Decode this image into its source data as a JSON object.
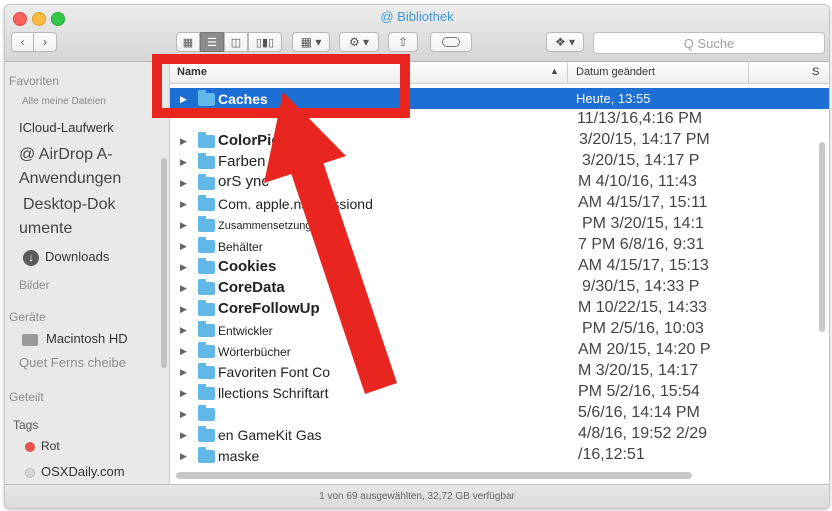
{
  "window": {
    "title": "@ Bibliothek"
  },
  "toolbar": {
    "search_placeholder": "Q Suche"
  },
  "sidebar": {
    "favorites_header": "Favoriten",
    "favorites": [
      "Alle meine Dateien",
      "ICloud-Laufwerk",
      "@ AirDrop A-",
      "Anwendungen",
      "Desktop-Dok",
      "umente",
      "Downloads",
      "Bilder"
    ],
    "devices_header": "Geräte",
    "devices": [
      "Macintosh HD",
      "Quet Ferns cheibe"
    ],
    "shared_header": "Geteilt",
    "tags_header": "Tags",
    "tags": [
      "Rot",
      "OSXDaily.com"
    ],
    "tag_colors": [
      "#e5534b",
      "#d7d7d7"
    ]
  },
  "columns": {
    "name": "Name",
    "date": "Datum geändert",
    "third": "S"
  },
  "rows": [
    {
      "name": "Caches",
      "date": "Heute, 13:55"
    },
    {
      "name": "",
      "date": "11/13/16,4:16 PM"
    },
    {
      "name": "ColorPick",
      "date": "3/20/15, 14:17 PM"
    },
    {
      "name": "Farben Col",
      "date": "3/20/15, 14:17 P"
    },
    {
      "name": "orS ync",
      "date": "M 4/10/16, 11:43"
    },
    {
      "name": "Com. apple.nsl Sessiond",
      "date": "AM 4/15/17, 15:11"
    },
    {
      "name": "Zusammensetzungen",
      "date": "PM 3/20/15, 14:1"
    },
    {
      "name": "Behälter",
      "date": "7 PM 6/8/16, 9:31"
    },
    {
      "name": "Cookies",
      "date": "AM 4/15/17, 15:13"
    },
    {
      "name": "CoreData",
      "date": "9/30/15, 14:33 P"
    },
    {
      "name": "CoreFollowUp",
      "date": "M 10/22/15, 14:33"
    },
    {
      "name": "Entwickler",
      "date": "PM 2/5/16, 10:03"
    },
    {
      "name": "Wörterbücher",
      "date": "AM 20/15, 14:20 P"
    },
    {
      "name": "Favoriten Font Co",
      "date": "M 3/20/15, 14:17"
    },
    {
      "name": "llections Schriftart",
      "date": "PM 5/2/16, 15:54"
    },
    {
      "name": "",
      "date": "5/6/16, 14:14 PM"
    },
    {
      "name": "en GameKit Gas",
      "date": "4/8/16, 19:52 2/29"
    },
    {
      "name": "maske",
      "date": "/16,12:51"
    }
  ],
  "status": {
    "text": "1 von 69 ausgewählten, 32,72 GB verfügbar"
  },
  "annotation": {
    "color": "#e8261f"
  }
}
